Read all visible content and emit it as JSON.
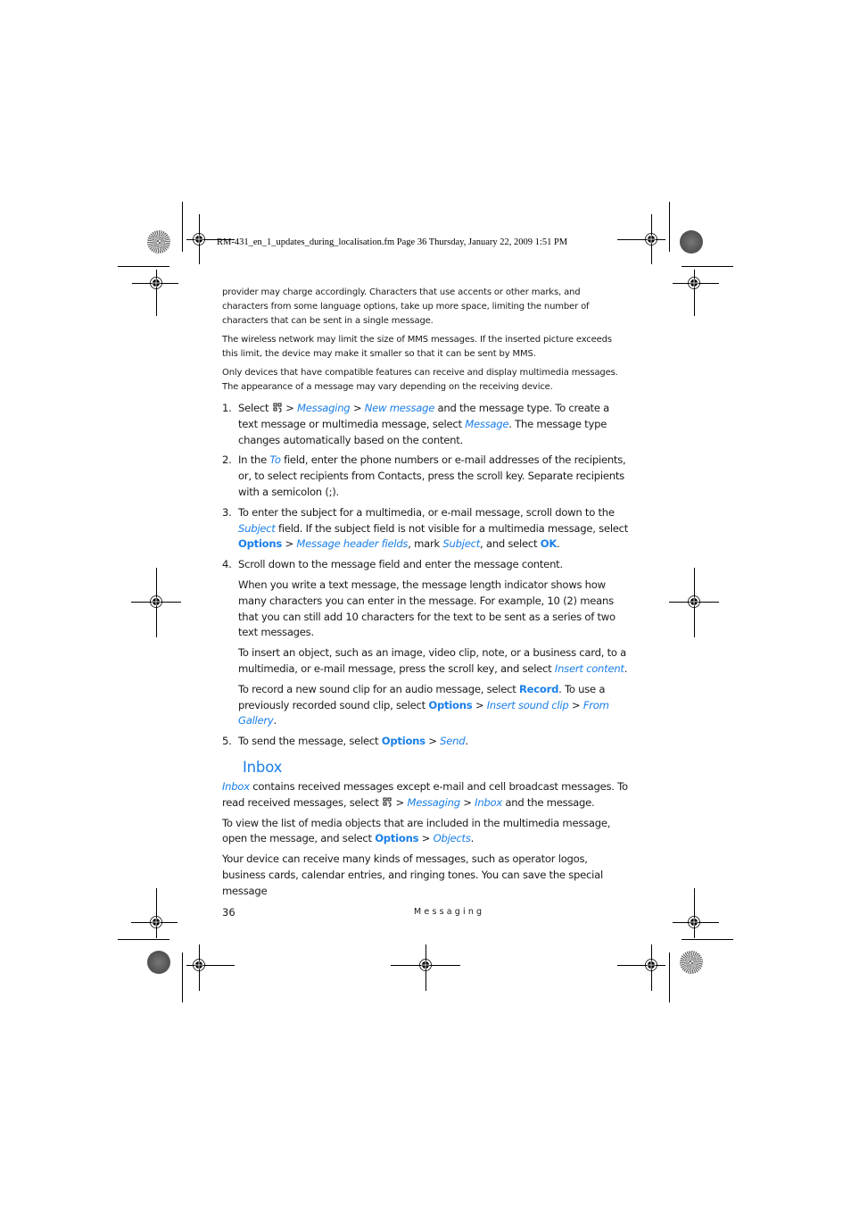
{
  "header": {
    "print_slug": "RM-431_en_1_updates_during_localisation.fm  Page 36  Thursday, January 22, 2009  1:51 PM"
  },
  "intro": [
    "provider may charge accordingly. Characters that use accents or other marks, and characters from some language options, take up more space, limiting the number of characters that can be sent in a single message.",
    "The wireless network may limit the size of MMS messages. If the inserted picture exceeds this limit, the device may make it smaller so that it can be sent by MMS.",
    "Only devices that have compatible features can receive and display multimedia messages. The appearance of a message may vary depending on the receiving device."
  ],
  "steps": {
    "s1": {
      "num": "1.",
      "t1": "Select ",
      "sep1": " > ",
      "l1": "Messaging",
      "sep2": " > ",
      "l2": "New message",
      "t2": " and the message type. To create a text message or multimedia message, select ",
      "l3": "Message",
      "t3": ". The message type changes automatically based on the content."
    },
    "s2": {
      "num": "2.",
      "t1": "In the ",
      "l1": "To",
      "t2": " field, enter the phone numbers or e-mail addresses of the recipients, or, to select recipients from Contacts, press the scroll key. Separate recipients with a semicolon (;)."
    },
    "s3": {
      "num": "3.",
      "t1": "To enter the subject for a multimedia, or e-mail message, scroll down to the ",
      "l1": "Subject",
      "t2": " field. If the subject field is not visible for a multimedia message, select ",
      "b1": "Options",
      "sep1": " > ",
      "l2": "Message header fields",
      "t3": ", mark ",
      "l3": "Subject",
      "t4": ", and select ",
      "b2": "OK",
      "t5": "."
    },
    "s4": {
      "num": "4.",
      "t1": "Scroll down to the message field and enter the message content.",
      "p1": "When you write a text message, the message length indicator shows how many characters you can enter in the message. For example, 10 (2) means that you can still add 10 characters for the text to be sent as a series of two text messages.",
      "p2_t1": "To insert an object, such as an image, video clip, note, or a business card, to a multimedia, or e-mail message, press the scroll key, and select ",
      "p2_l1": "Insert content",
      "p2_t2": ".",
      "p3_t1": "To record a new sound clip for an audio message, select ",
      "p3_b1": "Record",
      "p3_t2": ". To use a previously recorded sound clip, select ",
      "p3_b2": "Options",
      "p3_sep1": " > ",
      "p3_l1": "Insert sound clip",
      "p3_sep2": " > ",
      "p3_l2": "From Gallery",
      "p3_t3": "."
    },
    "s5": {
      "num": "5.",
      "t1": "To send the message, select ",
      "b1": "Options",
      "sep1": " > ",
      "l1": "Send",
      "t2": "."
    }
  },
  "inbox": {
    "heading": "Inbox",
    "p1_l1": "Inbox",
    "p1_t1": " contains received messages except e-mail and cell broadcast messages. To read received messages, select ",
    "p1_sep1": " > ",
    "p1_l2": "Messaging",
    "p1_sep2": " > ",
    "p1_l3": "Inbox",
    "p1_t2": " and the message.",
    "p2_t1": "To view the list of media objects that are included in the multimedia message, open the message, and select ",
    "p2_b1": "Options",
    "p2_sep1": " > ",
    "p2_l1": "Objects",
    "p2_t2": ".",
    "p3": "Your device can receive many kinds of messages, such as operator logos, business cards, calendar entries, and ringing tones. You can save the special message"
  },
  "footer": {
    "page_number": "36",
    "section": "Messaging"
  },
  "icons": {
    "menu_key": "menu-key-icon"
  },
  "colors": {
    "accent": "#1a7fe8",
    "text": "#1a1a1a"
  }
}
